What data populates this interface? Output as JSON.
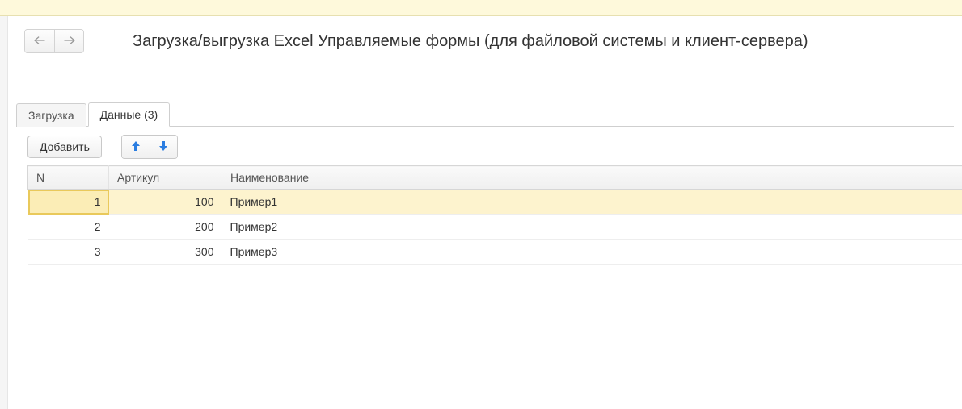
{
  "header": {
    "title": "Загрузка/выгрузка Excel Управляемые формы (для файловой системы и клиент-сервера)"
  },
  "tabs": [
    {
      "label": "Загрузка",
      "active": false
    },
    {
      "label": "Данные (3)",
      "active": true
    }
  ],
  "toolbar": {
    "add_label": "Добавить"
  },
  "table": {
    "columns": {
      "n": "N",
      "article": "Артикул",
      "name": "Наименование"
    },
    "rows": [
      {
        "n": "1",
        "article": "100",
        "name": "Пример1",
        "selected": true
      },
      {
        "n": "2",
        "article": "200",
        "name": "Пример2",
        "selected": false
      },
      {
        "n": "3",
        "article": "300",
        "name": "Пример3",
        "selected": false
      }
    ]
  }
}
